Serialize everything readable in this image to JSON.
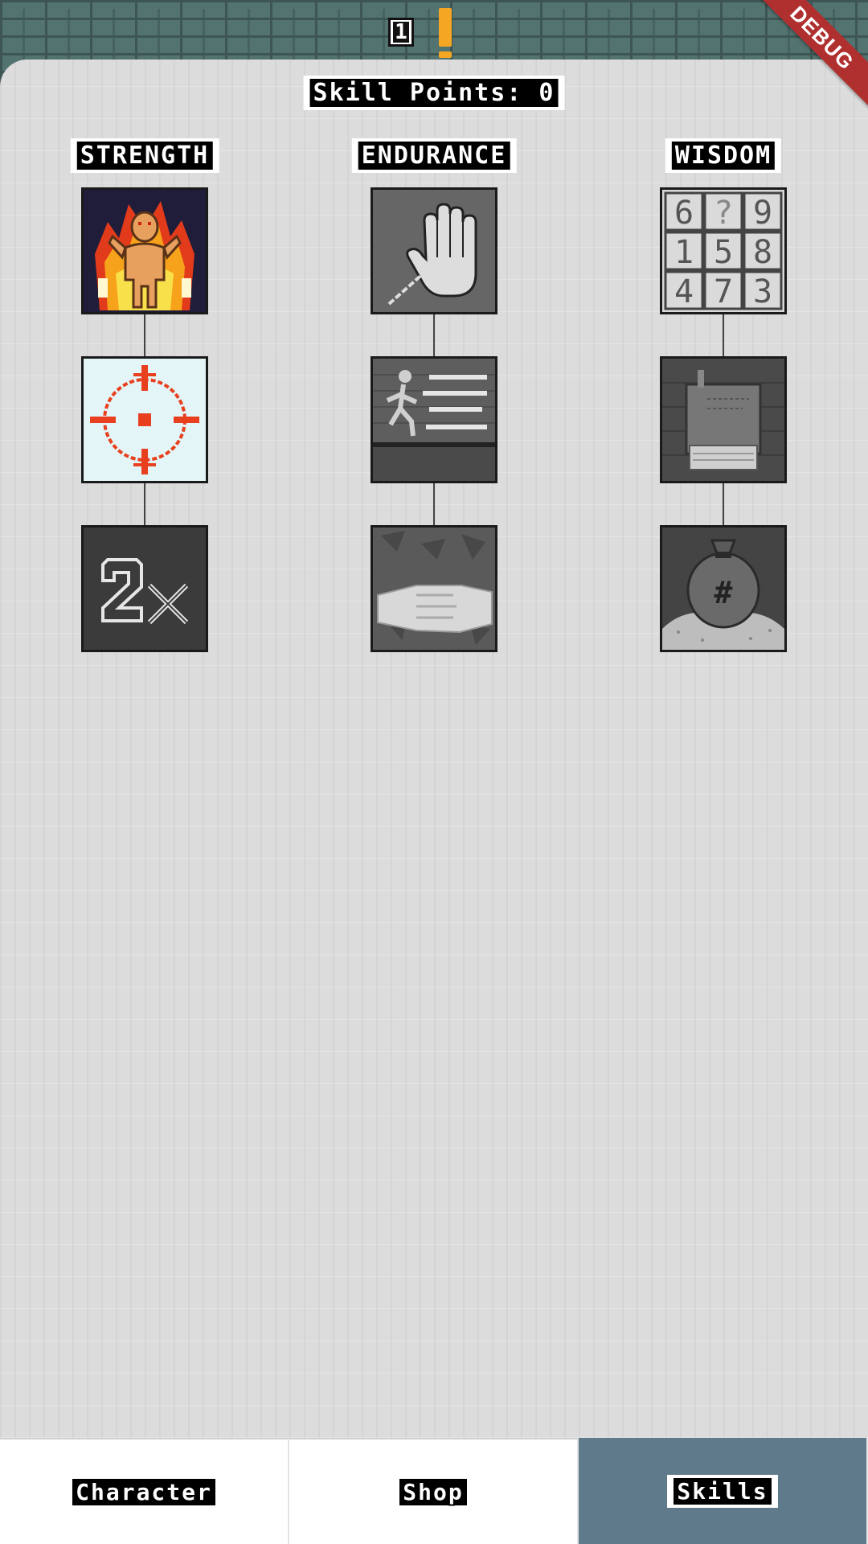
{
  "hud": {
    "level": "1",
    "alert_icon": "exclamation-icon",
    "debug_banner": "DEBUG"
  },
  "skills_panel": {
    "title": "Skill Points: 0",
    "columns": [
      {
        "header": "STRENGTH",
        "skills": [
          {
            "icon": "rage-fire-icon",
            "unlocked": true
          },
          {
            "icon": "crosshair-icon",
            "unlocked": true
          },
          {
            "icon": "double-damage-2x-icon",
            "unlocked": false
          }
        ]
      },
      {
        "header": "ENDURANCE",
        "skills": [
          {
            "icon": "dodge-hand-arrow-icon",
            "unlocked": false
          },
          {
            "icon": "sprint-runner-icon",
            "unlocked": false
          },
          {
            "icon": "iron-fist-icon",
            "unlocked": false
          }
        ]
      },
      {
        "header": "WISDOM",
        "skills": [
          {
            "icon": "number-puzzle-icon",
            "unlocked": false
          },
          {
            "icon": "ancient-scroll-icon",
            "unlocked": false
          },
          {
            "icon": "money-bag-icon",
            "unlocked": false
          }
        ]
      }
    ]
  },
  "bottom_nav": {
    "tabs": [
      {
        "label": "Character",
        "active": false
      },
      {
        "label": "Shop",
        "active": false
      },
      {
        "label": "Skills",
        "active": true
      }
    ]
  },
  "colors": {
    "active_tab": "#5f7b8b",
    "alert": "#f5a623",
    "debug_ribbon": "#b0302f",
    "crosshair": "#e8401f"
  }
}
